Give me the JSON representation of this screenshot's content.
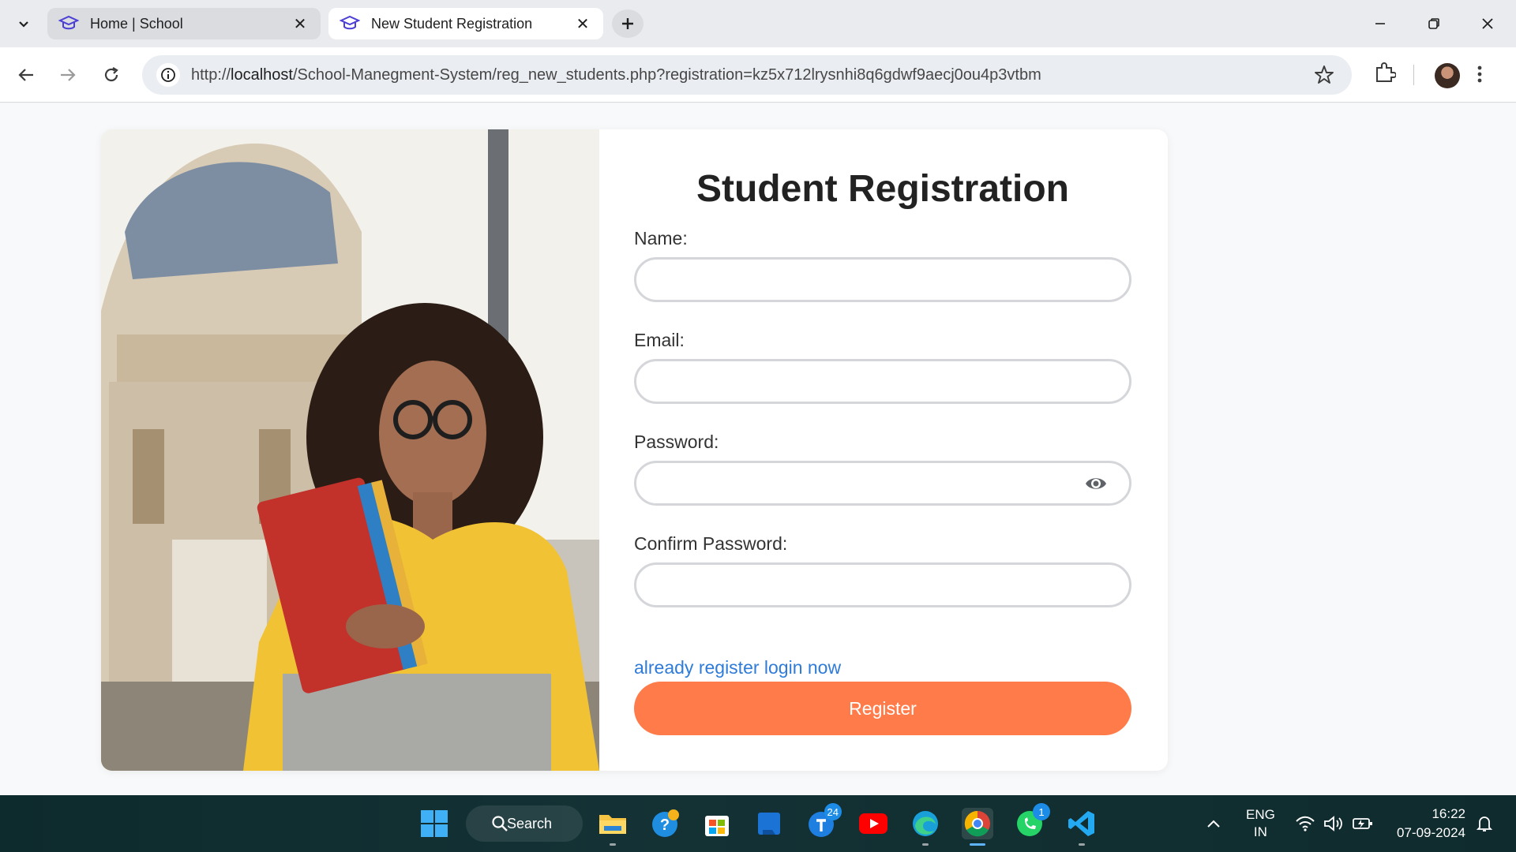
{
  "browser": {
    "tabs": [
      {
        "title": "Home | School",
        "active": false
      },
      {
        "title": "New Student Registration",
        "active": true
      }
    ],
    "url_prefix": "http://",
    "url_host": "localhost",
    "url_path": "/School-Manegment-System/reg_new_students.php?registration=kz5x712lrysnhi8q6gdwf9aecj0ou4p3vtbm"
  },
  "form": {
    "title": "Student Registration",
    "name_label": "Name:",
    "email_label": "Email:",
    "password_label": "Password:",
    "confirm_label": "Confirm Password:",
    "name_value": "",
    "email_value": "",
    "password_value": "",
    "confirm_value": "",
    "login_link": "already register login now",
    "register_button": "Register"
  },
  "colors": {
    "accent_button": "#ff7b4a",
    "link": "#2e7bd8"
  },
  "taskbar": {
    "search_label": "Search",
    "badges": {
      "teams": "24",
      "whatsapp": "1"
    },
    "language_line1": "ENG",
    "language_line2": "IN",
    "time": "16:22",
    "date": "07-09-2024"
  }
}
